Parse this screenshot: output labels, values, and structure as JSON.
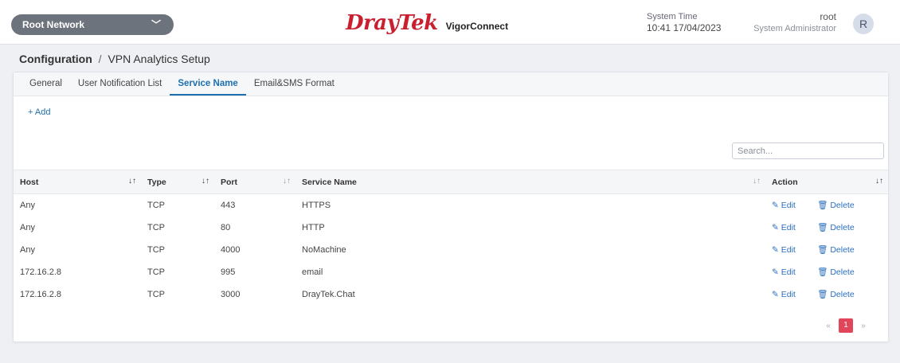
{
  "header": {
    "network_label": "Root Network",
    "brand_name": "DrayTek",
    "app_name": "VigorConnect",
    "system_time_label": "System Time",
    "system_time_value": "10:41 17/04/2023",
    "user_name": "root",
    "user_role": "System Administrator",
    "avatar_initial": "R"
  },
  "breadcrumb": {
    "root": "Configuration",
    "separator": "/",
    "current": "VPN Analytics Setup"
  },
  "tabs": [
    {
      "label": "General",
      "active": false
    },
    {
      "label": "User Notification List",
      "active": false
    },
    {
      "label": "Service Name",
      "active": true
    },
    {
      "label": "Email&SMS Format",
      "active": false
    }
  ],
  "toolbar": {
    "add_label": "+ Add",
    "search_placeholder": "Search..."
  },
  "table": {
    "columns": [
      "Host",
      "Type",
      "Port",
      "Service Name",
      "Action"
    ],
    "rows": [
      {
        "host": "Any",
        "type": "TCP",
        "port": "443",
        "service": "HTTPS"
      },
      {
        "host": "Any",
        "type": "TCP",
        "port": "80",
        "service": "HTTP"
      },
      {
        "host": "Any",
        "type": "TCP",
        "port": "4000",
        "service": "NoMachine"
      },
      {
        "host": "172.16.2.8",
        "type": "TCP",
        "port": "995",
        "service": "email"
      },
      {
        "host": "172.16.2.8",
        "type": "TCP",
        "port": "3000",
        "service": "DrayTek.Chat"
      }
    ],
    "edit_label": "Edit",
    "delete_label": "Delete"
  },
  "pagination": {
    "prev": "«",
    "current_page": "1",
    "next": "»"
  },
  "colors": {
    "brand_red": "#c8202f",
    "link_blue": "#1e6fb0",
    "page_active": "#e0455a"
  }
}
